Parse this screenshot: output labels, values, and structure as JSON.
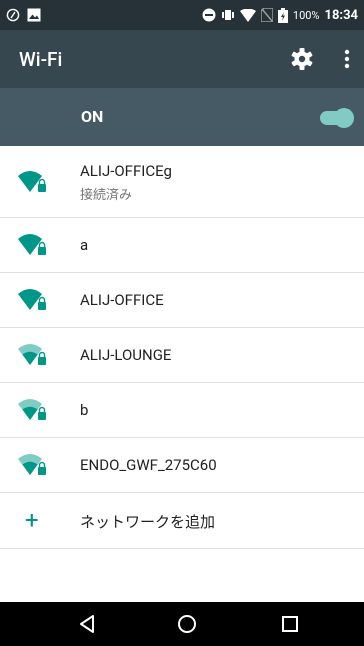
{
  "status_bar": {
    "battery_percent": "100%",
    "time": "18:34"
  },
  "toolbar": {
    "title": "Wi-Fi",
    "settings_icon": "gear-icon",
    "more_icon": "more-vert-icon"
  },
  "master_switch": {
    "label": "ON",
    "state": "on"
  },
  "networks": [
    {
      "ssid": "ALIJ-OFFICEg",
      "status": "接続済み",
      "signal": "full",
      "secured": true
    },
    {
      "ssid": "a",
      "status": "",
      "signal": "full",
      "secured": true
    },
    {
      "ssid": "ALIJ-OFFICE",
      "status": "",
      "signal": "full",
      "secured": true
    },
    {
      "ssid": "ALIJ-LOUNGE",
      "status": "",
      "signal": "medium",
      "secured": true
    },
    {
      "ssid": "b",
      "status": "",
      "signal": "medium",
      "secured": true
    },
    {
      "ssid": "ENDO_GWF_275C60",
      "status": "",
      "signal": "medium",
      "secured": true
    }
  ],
  "add_network": {
    "label": "ネットワークを追加"
  },
  "colors": {
    "status_bar": "#263238",
    "toolbar": "#37474f",
    "switch_bar": "#455a64",
    "accent": "#009688"
  }
}
